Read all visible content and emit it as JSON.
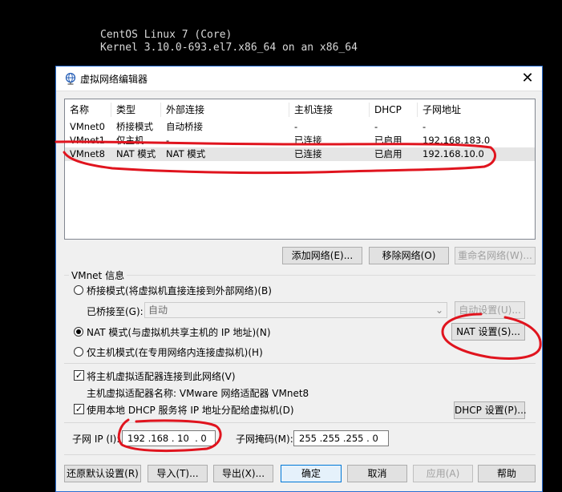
{
  "console": {
    "line1": "CentOS Linux 7 (Core)",
    "line2": "Kernel 3.10.0-693.el7.x86_64 on an x86_64"
  },
  "window": {
    "title": "虚拟网络编辑器",
    "close_icon": "close-icon"
  },
  "table": {
    "headers": [
      "名称",
      "类型",
      "外部连接",
      "主机连接",
      "DHCP",
      "子网地址"
    ],
    "rows": [
      [
        "VMnet0",
        "桥接模式",
        "自动桥接",
        "-",
        "-",
        "-"
      ],
      [
        "VMnet1",
        "仅主机...",
        "-",
        "已连接",
        "已启用",
        "192.168.183.0"
      ],
      [
        "VMnet8",
        "NAT 模式",
        "NAT 模式",
        "已连接",
        "已启用",
        "192.168.10.0"
      ]
    ],
    "selected_row": 2
  },
  "buttons": {
    "add_network": "添加网络(E)...",
    "remove_network": "移除网络(O)",
    "rename_network": "重命名网络(W)...",
    "auto_settings": "自动设置(U)...",
    "nat_settings": "NAT 设置(S)...",
    "dhcp_settings": "DHCP 设置(P)...",
    "restore_defaults": "还原默认设置(R)",
    "import": "导入(T)...",
    "export": "导出(X)...",
    "ok": "确定",
    "cancel": "取消",
    "apply": "应用(A)",
    "help": "帮助"
  },
  "vmnet_info": {
    "group_label": "VMnet 信息",
    "bridged_option": "桥接模式(将虚拟机直接连接到外部网络)(B)",
    "bridged_to_label": "已桥接至(G):",
    "bridged_to_value": "自动",
    "nat_option": "NAT 模式(与虚拟机共享主机的 IP 地址)(N)",
    "host_only_option": "仅主机模式(在专用网络内连接虚拟机)(H)",
    "selected_mode": "nat",
    "connect_adapter_label": "将主机虚拟适配器连接到此网络(V)",
    "connect_adapter_checked": true,
    "adapter_name_label": "主机虚拟适配器名称: VMware 网络适配器 VMnet8",
    "dhcp_label": "使用本地 DHCP 服务将 IP 地址分配给虚拟机(D)",
    "dhcp_checked": true,
    "subnet_ip_label": "子网 IP (I):",
    "subnet_ip_value": "192 .168 . 10  . 0",
    "subnet_mask_label": "子网掩码(M):",
    "subnet_mask_value": "255 .255 .255 . 0"
  },
  "annotation_color": "#e0141e"
}
